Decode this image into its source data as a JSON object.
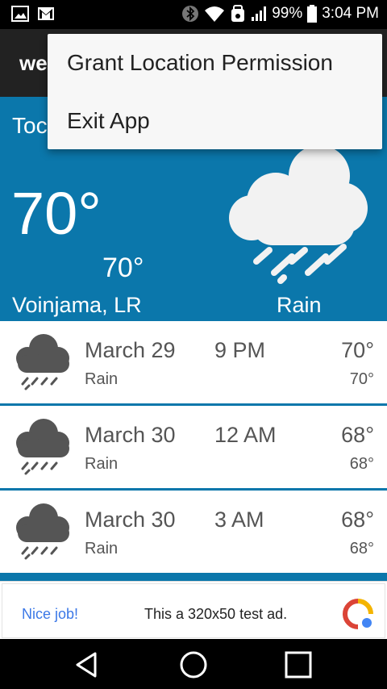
{
  "status_bar": {
    "battery": "99%",
    "time": "3:04 PM",
    "icons": [
      "image-icon",
      "gmail-icon",
      "bluetooth-icon",
      "wifi-icon",
      "alarm-icon",
      "signal-icon",
      "battery-icon"
    ]
  },
  "app_bar": {
    "title": "we"
  },
  "today": {
    "label": "Toc",
    "temp": "70°",
    "low": "70°",
    "location": "Voinjama, LR",
    "condition": "Rain",
    "icon": "rain-cloud-icon"
  },
  "forecast": [
    {
      "date": "March 29",
      "time": "9 PM",
      "high": "70°",
      "low": "70°",
      "condition": "Rain",
      "icon": "rain-cloud-icon"
    },
    {
      "date": "March 30",
      "time": "12 AM",
      "high": "68°",
      "low": "68°",
      "condition": "Rain",
      "icon": "rain-cloud-icon"
    },
    {
      "date": "March 30",
      "time": "3 AM",
      "high": "68°",
      "low": "68°",
      "condition": "Rain",
      "icon": "rain-cloud-icon"
    }
  ],
  "ad": {
    "nice_label": "Nice job!",
    "text": "This a 320x50 test ad."
  },
  "menu": {
    "items": [
      {
        "label": "Grant Location Permission"
      },
      {
        "label": "Exit App"
      }
    ]
  },
  "colors": {
    "today_bg": "#0b77ab",
    "app_bar_bg": "#222222",
    "forecast_text": "#555555",
    "ad_link": "#3b78e7"
  }
}
